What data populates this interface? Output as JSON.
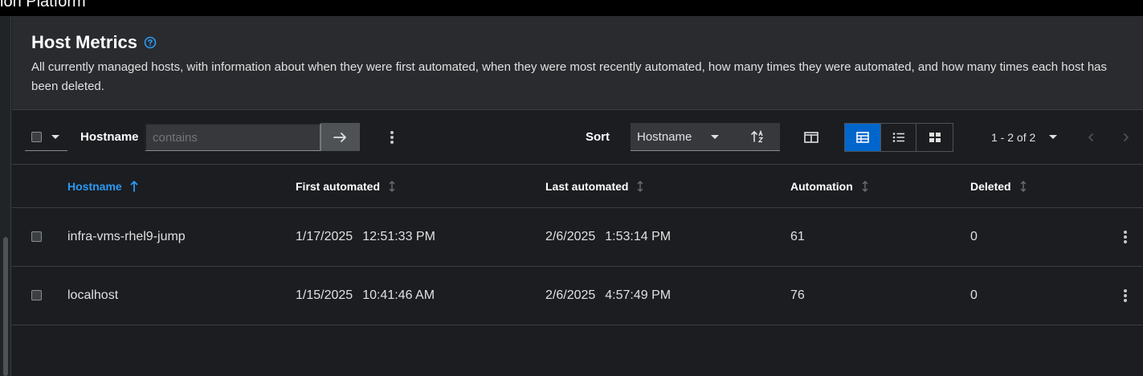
{
  "app": {
    "brand_text": "ion Platform"
  },
  "header": {
    "title": "Host Metrics",
    "description": "All currently managed hosts, with information about when they were first automated, when they were most recently automated, how many times they were automated, and how many times each host has been deleted."
  },
  "toolbar": {
    "filter_label": "Hostname",
    "filter_placeholder": "contains",
    "sort_label": "Sort",
    "sort_value": "Hostname",
    "pagination_text": "1 - 2 of 2"
  },
  "table": {
    "columns": [
      {
        "label": "Hostname",
        "sorted": "ascending"
      },
      {
        "label": "First automated",
        "sorted": "none"
      },
      {
        "label": "Last automated",
        "sorted": "none"
      },
      {
        "label": "Automation",
        "sorted": "none"
      },
      {
        "label": "Deleted",
        "sorted": "none"
      }
    ],
    "rows": [
      {
        "hostname": "infra-vms-rhel9-jump",
        "first_date": "1/17/2025",
        "first_time": "12:51:33 PM",
        "last_date": "2/6/2025",
        "last_time": "1:53:14 PM",
        "automation": "61",
        "deleted": "0"
      },
      {
        "hostname": "localhost",
        "first_date": "1/15/2025",
        "first_time": "10:41:46 AM",
        "last_date": "2/6/2025",
        "last_time": "4:57:49 PM",
        "automation": "76",
        "deleted": "0"
      }
    ]
  },
  "icons": {
    "help": "help-circle-icon",
    "filter_submit": "arrow-right-icon",
    "sort_direction": "sort-alpha-ascending-icon",
    "columns": "columns-icon",
    "views": [
      "table-view-icon",
      "list-view-icon",
      "grid-view-icon"
    ],
    "pager": [
      "chevron-left-icon",
      "chevron-right-icon"
    ]
  },
  "colors": {
    "accent": "#0066cc",
    "link": "#2b9af3",
    "background": "#1b1d21",
    "header_bg": "#292b2f"
  }
}
